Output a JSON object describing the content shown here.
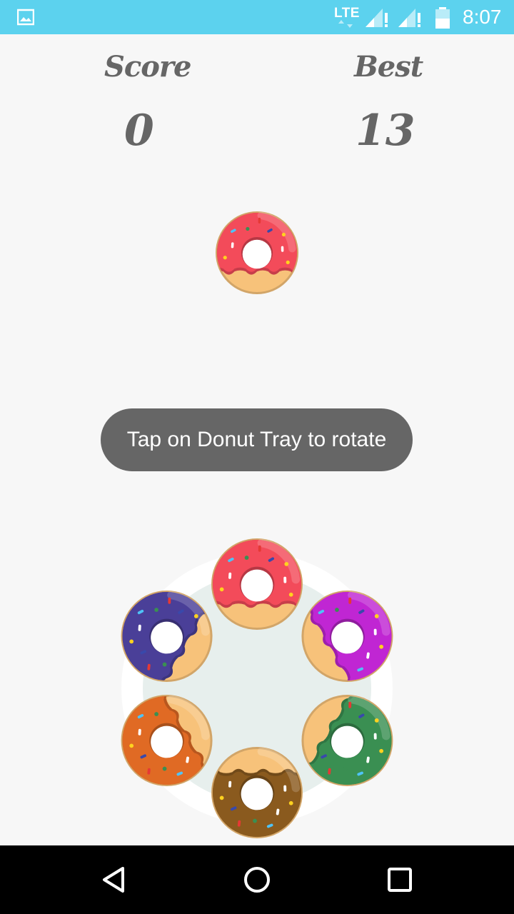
{
  "status_bar": {
    "network": "LTE",
    "time": "8:07",
    "background_color": "#5cd2ee",
    "icons": [
      "gallery-icon",
      "lte-icon",
      "signal-icon",
      "signal-icon",
      "battery-icon"
    ]
  },
  "scoreboard": {
    "score_label": "Score",
    "score_value": "0",
    "best_label": "Best",
    "best_value": "13"
  },
  "toast": {
    "message": "Tap on Donut Tray to rotate"
  },
  "falling_donut": {
    "color": "red"
  },
  "tray": {
    "donuts": [
      {
        "color": "red"
      },
      {
        "color": "purple"
      },
      {
        "color": "green"
      },
      {
        "color": "brown"
      },
      {
        "color": "orange"
      },
      {
        "color": "indigo"
      }
    ]
  },
  "colors": {
    "red": "#f34b5a",
    "purple": "#c026d3",
    "green": "#3a8f52",
    "brown": "#8a5a1e",
    "orange": "#e06a24",
    "indigo": "#4a3f98",
    "dough": "#f7c27a"
  },
  "nav_bar": {
    "icons": [
      "back-icon",
      "home-icon",
      "recents-icon"
    ]
  }
}
